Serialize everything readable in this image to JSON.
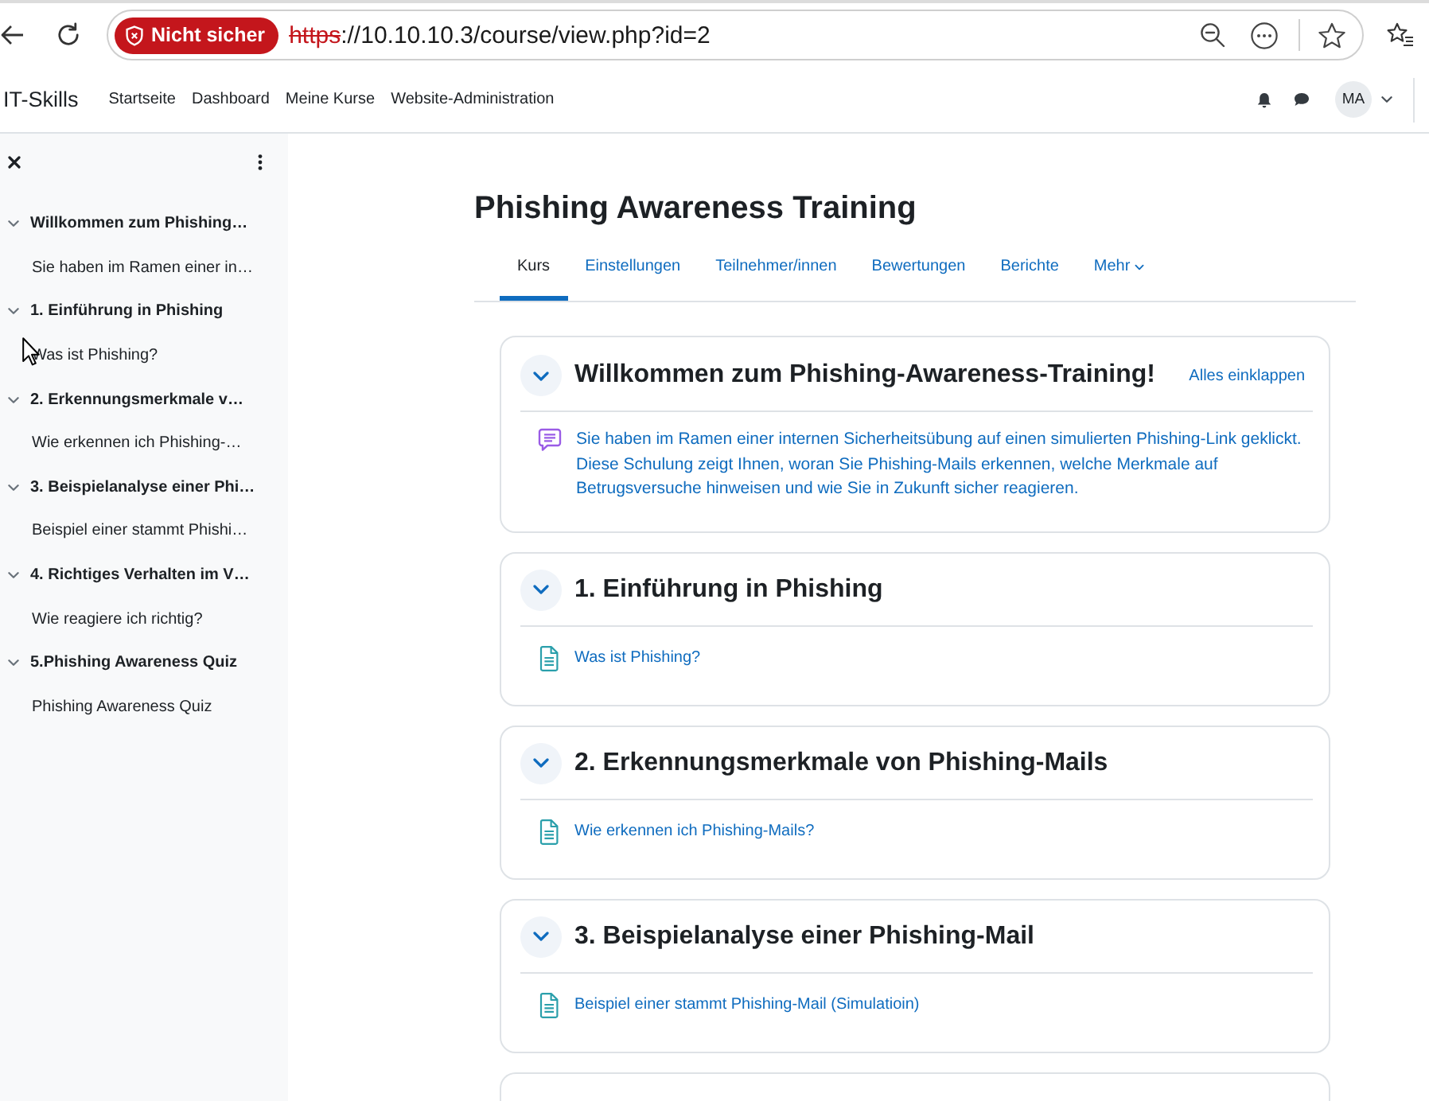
{
  "browser": {
    "secure": false,
    "security_label": "Nicht sicher",
    "url_scheme": "https",
    "url_rest": "://10.10.10.3/course/view.php?id=2"
  },
  "navbar": {
    "site_name": "IT-Skills",
    "links": [
      "Startseite",
      "Dashboard",
      "Meine Kurse",
      "Website-Administration"
    ],
    "avatar_initials": "MA"
  },
  "course_index": {
    "sections": [
      {
        "title": "Willkommen zum Phishing…",
        "expanded": true,
        "items": [
          "Sie haben im Ramen einer in…"
        ]
      },
      {
        "title": "1. Einführung in Phishing",
        "expanded": true,
        "items": [
          "Was ist Phishing?"
        ]
      },
      {
        "title": "2. Erkennungsmerkmale v…",
        "expanded": true,
        "items": [
          "Wie erkennen ich Phishing-…"
        ]
      },
      {
        "title": "3. Beispielanalyse einer Phi…",
        "expanded": true,
        "items": [
          "Beispiel einer stammt Phishi…"
        ]
      },
      {
        "title": "4. Richtiges Verhalten im V…",
        "expanded": true,
        "items": [
          "Wie reagiere ich richtig?"
        ]
      },
      {
        "title": "5.Phishing Awareness Quiz",
        "expanded": true,
        "items": [
          "Phishing Awareness Quiz"
        ]
      }
    ]
  },
  "course": {
    "title": "Phishing Awareness Training",
    "tabs": [
      {
        "label": "Kurs",
        "selected": true,
        "kind": "link"
      },
      {
        "label": "Einstellungen",
        "selected": false,
        "kind": "link"
      },
      {
        "label": "Teilnehmer/innen",
        "selected": false,
        "kind": "link"
      },
      {
        "label": "Bewertungen",
        "selected": false,
        "kind": "link"
      },
      {
        "label": "Berichte",
        "selected": false,
        "kind": "link"
      },
      {
        "label": "Mehr",
        "selected": false,
        "kind": "menu"
      }
    ],
    "collapse_all": "Alles einklappen",
    "sections": [
      {
        "kind": "full",
        "title": "Willkommen zum Phishing-Awareness-Training!",
        "expanded": true,
        "activities": [
          {
            "kind": "text",
            "paragraphs": [
              "Sie haben im Ramen einer internen Sicherheitsübung auf einen simulierten Phishing-Link geklickt.",
              "Diese Schulung zeigt Ihnen, woran Sie Phishing-Mails erkennen, welche Merkmale auf Betrugsversuche hinweisen und wie Sie in Zukunft sicher reagieren."
            ]
          }
        ]
      },
      {
        "kind": "full",
        "title": "1. Einführung in Phishing",
        "expanded": true,
        "activities": [
          {
            "kind": "page",
            "name": "Was ist Phishing?"
          }
        ]
      },
      {
        "kind": "full",
        "title": "2. Erkennungsmerkmale von Phishing-Mails",
        "expanded": true,
        "activities": [
          {
            "kind": "page",
            "name": "Wie erkennen ich Phishing-Mails?"
          }
        ]
      },
      {
        "kind": "full",
        "title": "3. Beispielanalyse einer Phishing-Mail",
        "expanded": true,
        "activities": [
          {
            "kind": "page",
            "name": "Beispiel einer stammt Phishing-Mail (Simulatioin)"
          }
        ]
      },
      {
        "kind": "clipped"
      }
    ]
  }
}
